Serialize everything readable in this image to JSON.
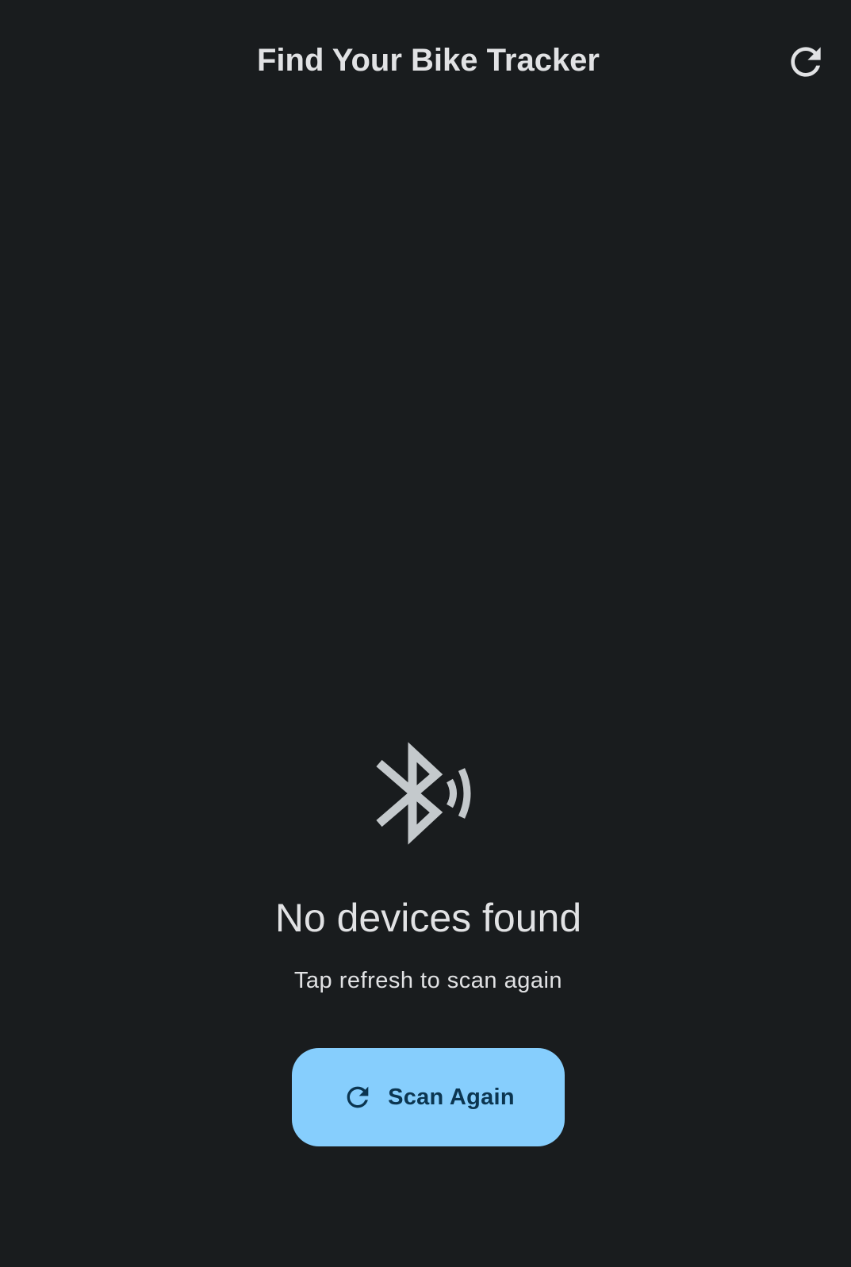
{
  "app_bar": {
    "title": "Find Your Bike Tracker",
    "refresh_icon": "refresh-icon"
  },
  "empty_state": {
    "icon": "bluetooth-searching-icon",
    "title": "No devices found",
    "subtitle": "Tap refresh to scan again",
    "button": {
      "label": "Scan Again",
      "icon": "refresh-icon"
    }
  },
  "colors": {
    "background": "#191c1e",
    "on_surface": "#e1e2e4",
    "icon_muted": "#c4c9cc",
    "primary_container": "#86cefd",
    "on_primary_container": "#0b3550"
  }
}
